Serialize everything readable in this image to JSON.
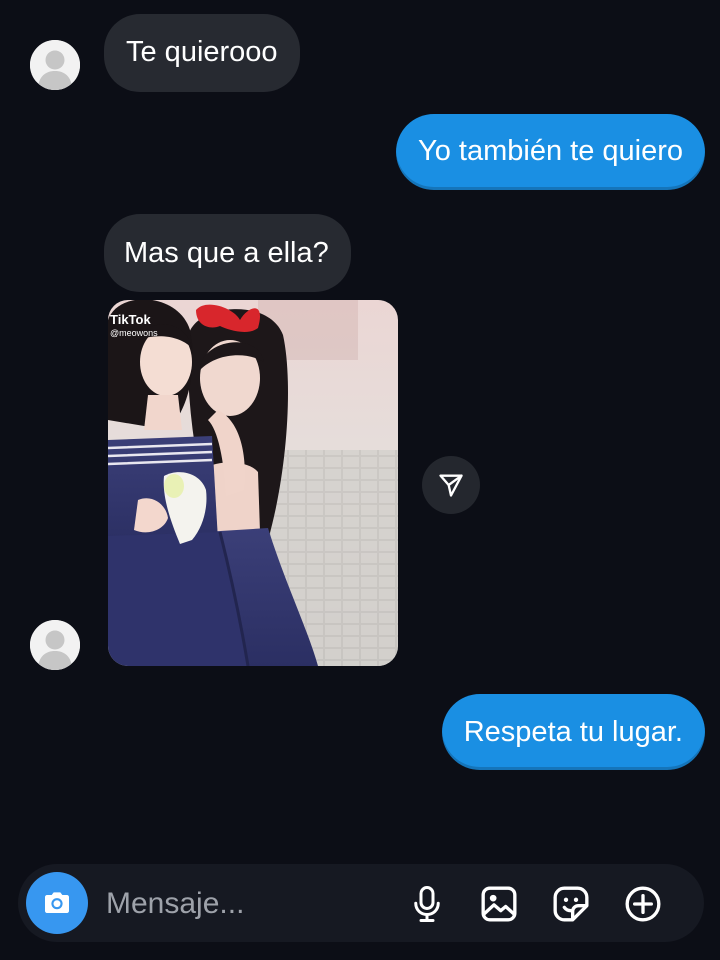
{
  "messages": [
    {
      "direction": "incoming",
      "text": "Te quierooo"
    },
    {
      "direction": "outgoing",
      "text": "Yo también te quiero"
    },
    {
      "direction": "incoming",
      "text": "Mas que a ella?"
    },
    {
      "direction": "incoming",
      "type": "shared-video",
      "watermark_app": "TikTok",
      "watermark_user": "@meowons"
    },
    {
      "direction": "outgoing",
      "text": "Respeta tu lugar."
    }
  ],
  "composer": {
    "placeholder": "Mensaje...",
    "icons": [
      "camera-icon",
      "microphone-icon",
      "gallery-icon",
      "sticker-icon",
      "add-icon"
    ]
  },
  "icons": {
    "share": "send-icon",
    "avatar": "default-avatar-icon"
  },
  "colors": {
    "background": "#0c0e16",
    "incoming_bubble": "#272a31",
    "outgoing_bubble": "#1a8fe3",
    "camera_button": "#3797f0",
    "placeholder": "#9ea2aa"
  }
}
